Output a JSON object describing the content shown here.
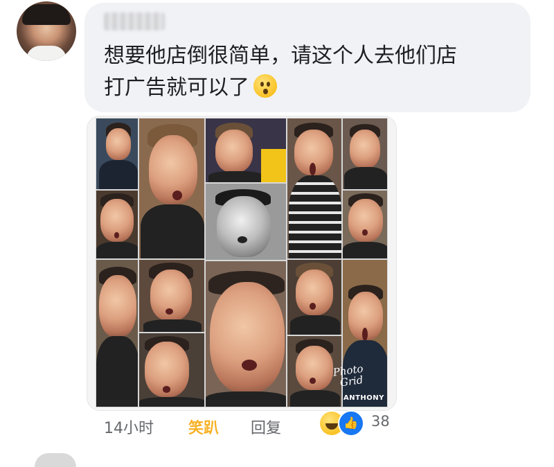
{
  "comment": {
    "text_line1": "想要他店倒很简单，请这个人去他们店",
    "text_line2": "打广告就可以了",
    "emoji": "astonished-face-icon"
  },
  "photo": {
    "sticker_text_line1": "Photo",
    "sticker_text_line2": "Grid",
    "bottom_text": "ANTHONY"
  },
  "meta": {
    "time": "14小时",
    "laugh_label": "笑趴",
    "reply_label": "回复"
  },
  "reactions": {
    "icons": [
      "haha-icon",
      "like-icon"
    ],
    "count": "38"
  },
  "colors": {
    "bubble_bg": "#f0f2f5",
    "laugh_active": "#f7b125",
    "like_blue": "#1877f2",
    "meta_text": "#65676b"
  }
}
